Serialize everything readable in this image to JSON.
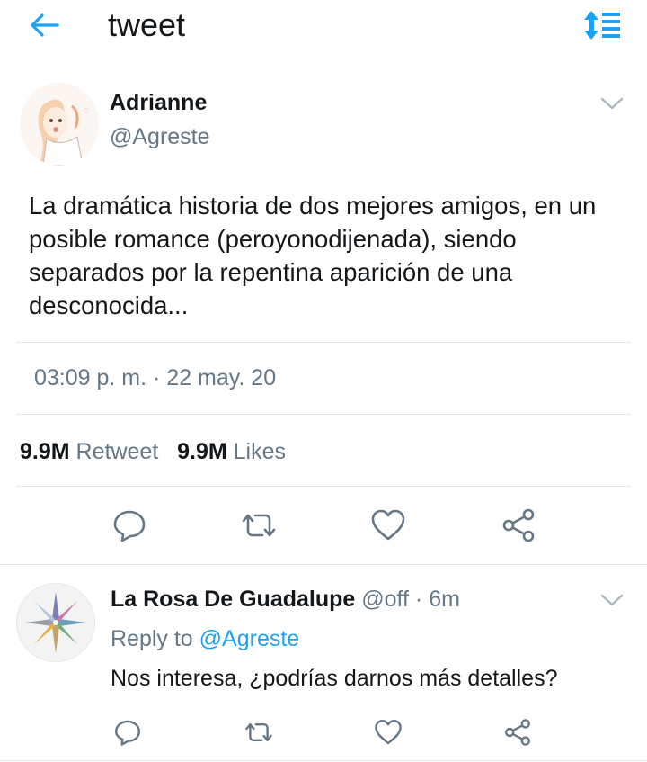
{
  "header": {
    "title": "tweet",
    "back_icon": "back-arrow-icon",
    "sort_icon": "sort-icon",
    "accent_color": "#1da1f2"
  },
  "tweet": {
    "author_name": "Adrianne",
    "author_handle": "@Agreste",
    "text": "La dramática historia de dos mejores amigos, en un posible romance (peroyonodijenada), siendo separados por la repentina aparición de una desconocida...",
    "timestamp": "03:09 p. m. · 22 may. 20",
    "retweets_count": "9.9M",
    "retweets_label": "Retweet",
    "likes_count": "9.9M",
    "likes_label": "Likes",
    "actions": [
      "reply-icon",
      "retweet-icon",
      "like-icon",
      "share-icon"
    ]
  },
  "reply": {
    "author_name": "La Rosa De Guadalupe",
    "meta": "@off · 6m",
    "reply_to_prefix": "Reply to",
    "reply_to_handle": "@Agreste",
    "text": "Nos interesa, ¿podrías darnos más detalles?",
    "actions": [
      "reply-icon",
      "retweet-icon",
      "like-icon",
      "share-icon"
    ]
  },
  "colors": {
    "text_primary": "#14171a",
    "text_secondary": "#657786",
    "link": "#1da1f2",
    "divider": "#e1e8ed"
  }
}
